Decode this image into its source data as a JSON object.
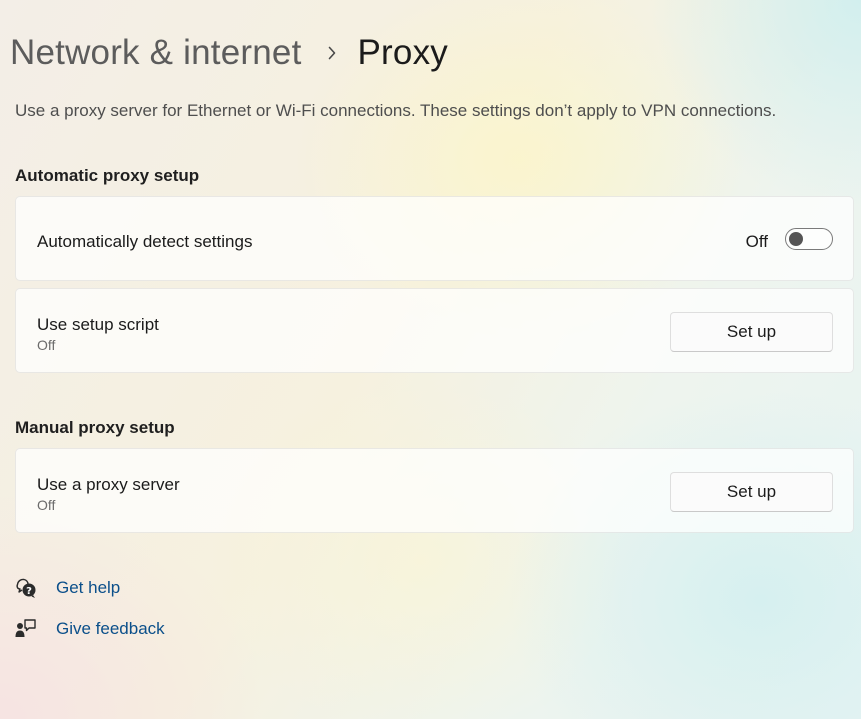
{
  "breadcrumb": {
    "parent": "Network & internet",
    "current": "Proxy"
  },
  "description": "Use a proxy server for Ethernet or Wi-Fi connections. These settings don’t apply to VPN connections.",
  "automatic": {
    "title": "Automatic proxy setup",
    "detect": {
      "label": "Automatically detect settings",
      "state_label": "Off",
      "enabled": false
    },
    "script": {
      "label": "Use setup script",
      "status": "Off",
      "button": "Set up"
    }
  },
  "manual": {
    "title": "Manual proxy setup",
    "proxy": {
      "label": "Use a proxy server",
      "status": "Off",
      "button": "Set up"
    }
  },
  "links": {
    "help": "Get help",
    "feedback": "Give feedback"
  },
  "icons": {
    "separator": "chevron-right-icon",
    "help": "help-chat-icon",
    "feedback": "feedback-person-icon"
  },
  "colors": {
    "link": "#0b4f8a",
    "toggle_knob_off": "#555555"
  }
}
